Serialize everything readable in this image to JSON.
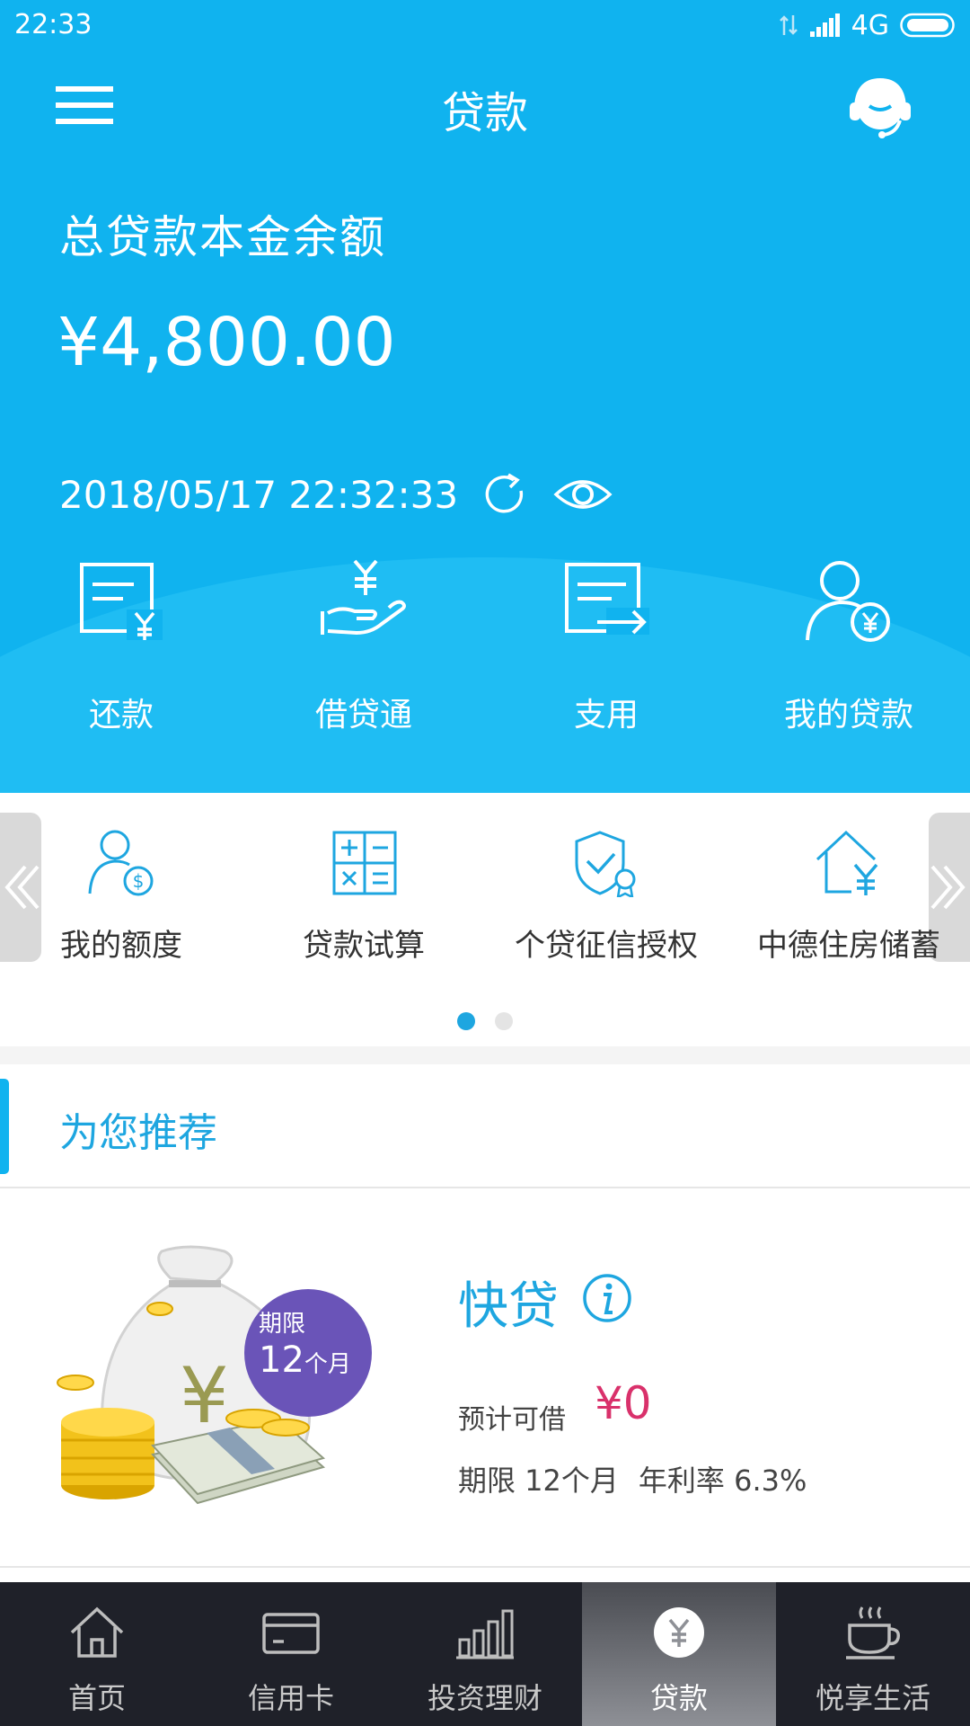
{
  "status_bar": {
    "time": "22:33",
    "network": "4G"
  },
  "header": {
    "title": "贷款"
  },
  "balance": {
    "label": "总贷款本金余额",
    "amount": "¥4,800.00",
    "timestamp": "2018/05/17 22:32:33"
  },
  "hero_actions": [
    {
      "label": "还款",
      "icon": "repay-icon"
    },
    {
      "label": "借贷通",
      "icon": "loan-hand-icon"
    },
    {
      "label": "支用",
      "icon": "withdraw-icon"
    },
    {
      "label": "我的贷款",
      "icon": "my-loan-icon"
    }
  ],
  "quick_tools": [
    {
      "label": "我的额度",
      "icon": "quota-icon"
    },
    {
      "label": "贷款试算",
      "icon": "calculator-icon"
    },
    {
      "label": "个贷征信授权",
      "icon": "credit-shield-icon"
    },
    {
      "label": "中德住房储蓄",
      "icon": "house-savings-icon"
    }
  ],
  "carousel": {
    "page": 1,
    "pages": 2
  },
  "recommend": {
    "title": "为您推荐",
    "product": {
      "name": "快贷",
      "badge_top": "期限",
      "badge_number": "12",
      "badge_unit": "个月",
      "est_label": "预计可借",
      "est_value": "¥0",
      "term": "期限 12个月",
      "rate": "年利率 6.3%"
    }
  },
  "tabs": [
    {
      "label": "首页",
      "icon": "home-icon"
    },
    {
      "label": "信用卡",
      "icon": "card-icon"
    },
    {
      "label": "投资理财",
      "icon": "chart-bars-icon"
    },
    {
      "label": "贷款",
      "icon": "yen-coin-icon",
      "active": true
    },
    {
      "label": "悦享生活",
      "icon": "coffee-cup-icon"
    }
  ],
  "colors": {
    "hero_blue": "#10b3ef",
    "accent_blue": "#1ea6e0",
    "amount_red": "#d9316b",
    "badge_purple": "#6a54b8",
    "tabbar_dark": "#1f2129"
  }
}
